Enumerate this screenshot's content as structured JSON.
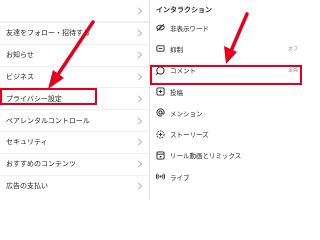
{
  "left_pane": {
    "items": [
      {
        "label": "",
        "icon": "chevron-right-icon"
      },
      {
        "label": "友達をフォロー・招待する",
        "icon": "chevron-right-icon"
      },
      {
        "label": "お知らせ",
        "icon": "chevron-right-icon"
      },
      {
        "label": "ビジネス",
        "icon": "chevron-right-icon"
      },
      {
        "label": "プライバシー設定",
        "icon": "chevron-right-icon",
        "highlighted": true
      },
      {
        "label": "ペアレンタルコントロール",
        "icon": "chevron-right-icon"
      },
      {
        "label": "セキュリティ",
        "icon": "chevron-right-icon"
      },
      {
        "label": "おすすめのコンテンツ",
        "icon": "chevron-right-icon"
      },
      {
        "label": "広告の支払い",
        "icon": "chevron-right-icon"
      }
    ]
  },
  "right_pane": {
    "section_title": "インタラクション",
    "items": [
      {
        "label": "非表示ワード",
        "status": "",
        "icon": "eye-off-icon"
      },
      {
        "label": "抑制",
        "status": "オフ",
        "icon": "restrict-icon"
      },
      {
        "label": "コメント",
        "status": "全員",
        "icon": "comment-bubble-icon",
        "highlighted": true
      },
      {
        "label": "投稿",
        "status": "",
        "icon": "plus-square-icon"
      },
      {
        "label": "メンション",
        "status": "",
        "icon": "at-sign-icon"
      },
      {
        "label": "ストーリーズ",
        "status": "",
        "icon": "story-ring-icon"
      },
      {
        "label": "リール動画とリミックス",
        "status": "",
        "icon": "reels-icon"
      },
      {
        "label": "ライブ",
        "status": "",
        "icon": "live-icon"
      }
    ]
  },
  "colors": {
    "highlight": "#e4001b",
    "arrow": "#e4001b",
    "text": "#262626",
    "muted": "#8e8e8e",
    "divider": "#efefef"
  }
}
